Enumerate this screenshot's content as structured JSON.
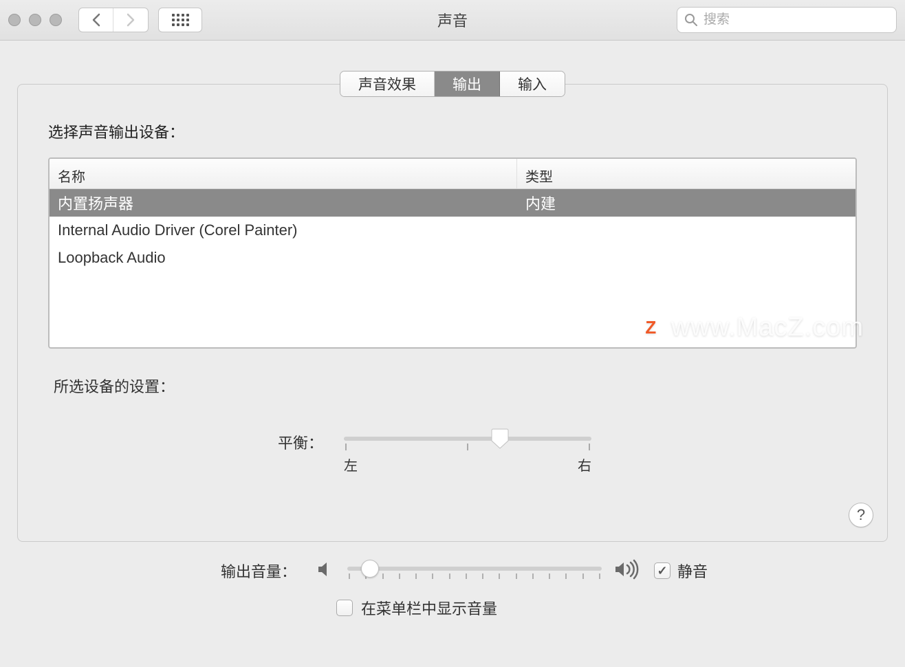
{
  "window": {
    "title": "声音"
  },
  "search": {
    "placeholder": "搜索"
  },
  "tabs": [
    {
      "label": "声音效果",
      "active": false
    },
    {
      "label": "输出",
      "active": true
    },
    {
      "label": "输入",
      "active": false
    }
  ],
  "output": {
    "select_label": "选择声音输出设备：",
    "columns": {
      "name": "名称",
      "type": "类型"
    },
    "devices": [
      {
        "name": "内置扬声器",
        "type": "内建",
        "selected": true
      },
      {
        "name": "Internal Audio Driver (Corel Painter)",
        "type": "",
        "selected": false
      },
      {
        "name": "Loopback Audio",
        "type": "",
        "selected": false
      }
    ],
    "settings_label": "所选设备的设置：",
    "balance": {
      "label": "平衡：",
      "left": "左",
      "right": "右",
      "value": 63
    }
  },
  "volume": {
    "label": "输出音量：",
    "value": 9,
    "mute_label": "静音",
    "mute_checked": true,
    "show_in_menubar_label": "在菜单栏中显示音量",
    "show_in_menubar_checked": false
  },
  "help_label": "?",
  "watermark": "www.MacZ.com"
}
